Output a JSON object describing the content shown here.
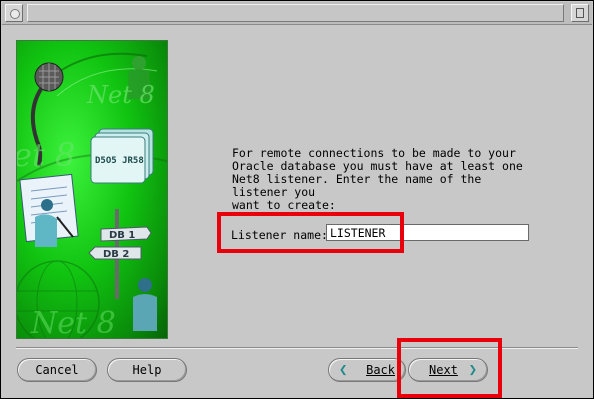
{
  "window": {
    "title": ""
  },
  "illustration": {
    "labels": {
      "net8_top": "Net 8",
      "net8_mid": "et 8",
      "folder_tag": "D5O5 JR58",
      "db1": "DB 1",
      "db2": "DB 2",
      "net8_bottom": "Net 8"
    }
  },
  "content": {
    "description": "For remote connections to be made to your\nOracle database you must have at least one\nNet8 listener. Enter the name of the listener you\nwant to create:",
    "listener_label": "Listener name:",
    "listener_value": "LISTENER"
  },
  "buttons": {
    "cancel": "Cancel",
    "help": "Help",
    "back": "Back",
    "next": "Next"
  },
  "colors": {
    "highlight": "#e8000b",
    "illustration_green": "#11c411",
    "nav_arrow": "#1f8a8a"
  }
}
